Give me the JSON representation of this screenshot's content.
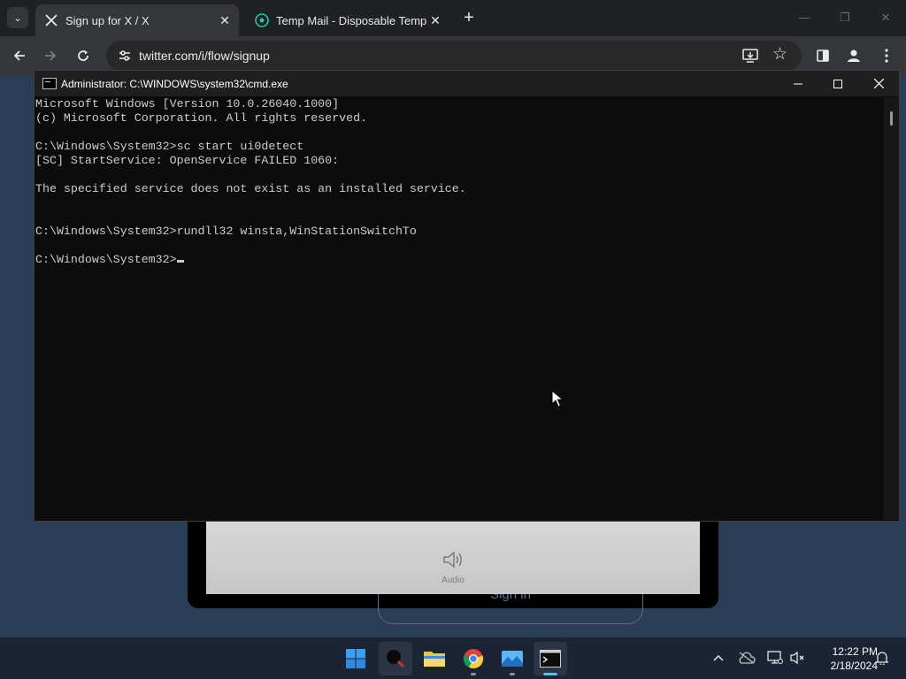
{
  "browser": {
    "tabs": [
      {
        "title": "Sign up for X / X",
        "active": true,
        "favicon": "x-logo-icon"
      },
      {
        "title": "Temp Mail - Disposable Tempor",
        "active": false,
        "favicon": "tempmail-icon"
      }
    ],
    "close_glyph": "✕",
    "newtab_glyph": "+",
    "url": "twitter.com/i/flow/signup"
  },
  "cmd": {
    "title": "Administrator: C:\\WINDOWS\\system32\\cmd.exe",
    "lines": [
      "Microsoft Windows [Version 10.0.26040.1000]",
      "(c) Microsoft Corporation. All rights reserved.",
      "",
      "C:\\Windows\\System32>sc start ui0detect",
      "[SC] StartService: OpenService FAILED 1060:",
      "",
      "The specified service does not exist as an installed service.",
      "",
      "",
      "C:\\Windows\\System32>rundll32 winsta,WinStationSwitchTo",
      "",
      "C:\\Windows\\System32>"
    ]
  },
  "page": {
    "audio_label": "Audio",
    "signin_label": "Sign in"
  },
  "taskbar": {
    "apps": [
      "windows-start-icon",
      "search-icon",
      "file-explorer-icon",
      "chrome-icon",
      "photos-icon",
      "terminal-icon"
    ],
    "time": "12:22 PM",
    "date": "2/18/2024"
  },
  "colors": {
    "console_bg": "#0c0c0c",
    "console_text": "#cccccc",
    "taskbar_accent": "#4cc2ff"
  }
}
